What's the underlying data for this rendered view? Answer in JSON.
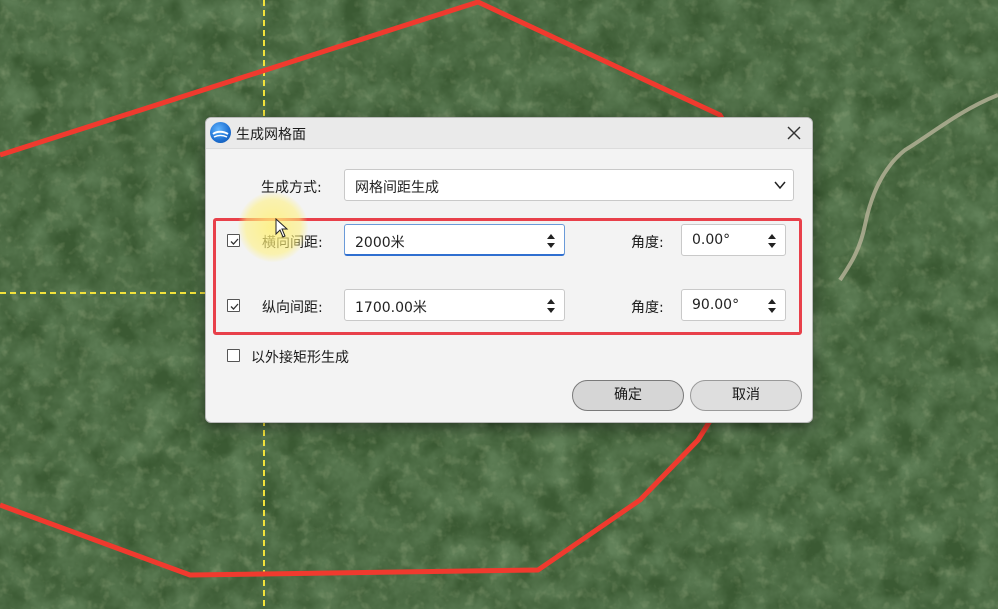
{
  "dialog": {
    "title": "生成网格面",
    "method_label": "生成方式:",
    "method_value": "网格间距生成",
    "horizontal": {
      "checked": true,
      "label": "横向间距:",
      "value": "2000米",
      "angle_label": "角度:",
      "angle_value": "0.00°"
    },
    "vertical": {
      "checked": true,
      "label": "纵向间距:",
      "value": "1700.00米",
      "angle_label": "角度:",
      "angle_value": "90.00°"
    },
    "bbox_option": {
      "checked": false,
      "label": "以外接矩形生成"
    },
    "ok_label": "确定",
    "cancel_label": "取消"
  },
  "colors": {
    "highlight_frame": "#e8404a",
    "boundary_line": "#f03a2e",
    "grid_line": "#f2e33b"
  },
  "icons": [
    "app-logo-icon",
    "close-icon",
    "chevron-down-icon",
    "spin-arrows-icon",
    "checkmark-icon",
    "mouse-pointer-icon"
  ]
}
